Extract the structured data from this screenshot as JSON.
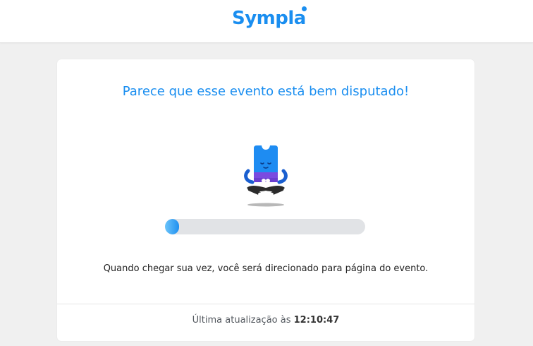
{
  "header": {
    "logo_text": "Sympla",
    "brand_color": "#1a8ef0"
  },
  "queue": {
    "title": "Parece que esse evento está bem disputado!",
    "mascot_icon": "meditating-ticket-mascot",
    "progress_fraction": 0.07,
    "message": "Quando chegar sua vez, você será direcionado para página do evento.",
    "last_update_label": "Última atualização às",
    "last_update_time": "12:10:47"
  }
}
